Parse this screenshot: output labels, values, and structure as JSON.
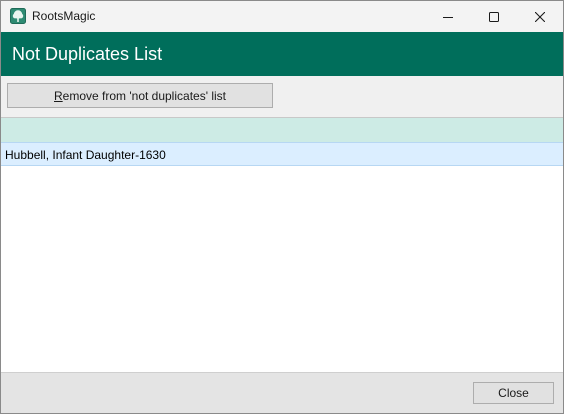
{
  "window": {
    "app_title": "RootsMagic",
    "app_icon": "tree-icon",
    "controls": [
      "minimize-icon",
      "maximize-icon",
      "close-icon"
    ]
  },
  "header": {
    "title": "Not Duplicates List",
    "color": "#006e5b"
  },
  "toolbar": {
    "remove_label_accel": "R",
    "remove_label_rest": "emove from 'not duplicates' list"
  },
  "list": {
    "header_color": "#cdebe5",
    "rows": [
      {
        "label": "Hubbell, Infant Daughter-1630",
        "selected": true
      }
    ]
  },
  "footer": {
    "close_label": "Close"
  }
}
